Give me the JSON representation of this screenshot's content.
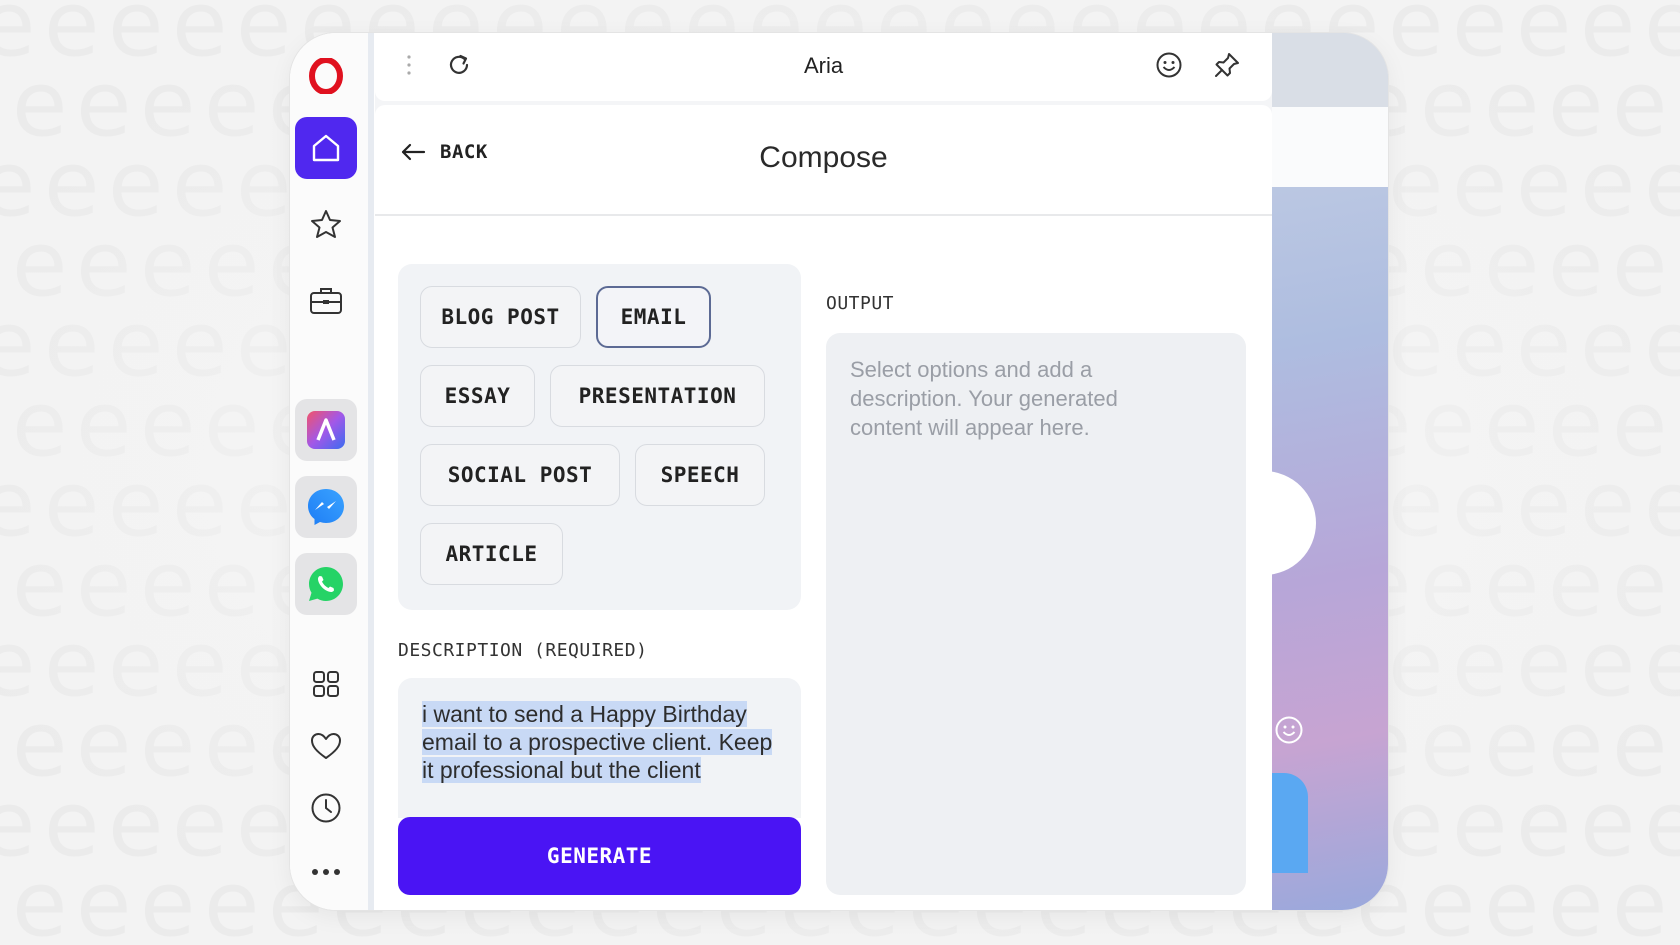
{
  "window": {
    "title": "Aria"
  },
  "sidebar": {
    "items": [
      {
        "icon": "opera-logo-icon",
        "active": false
      },
      {
        "icon": "home-icon",
        "active": true
      },
      {
        "icon": "star-icon",
        "active": false
      },
      {
        "icon": "briefcase-icon",
        "active": false
      },
      {
        "icon": "aria-app-icon",
        "active": false
      },
      {
        "icon": "messenger-icon",
        "active": false
      },
      {
        "icon": "whatsapp-icon",
        "active": false
      },
      {
        "icon": "grid-icon",
        "active": false
      },
      {
        "icon": "heart-icon",
        "active": false
      },
      {
        "icon": "clock-icon",
        "active": false
      },
      {
        "icon": "more-icon",
        "active": false
      }
    ]
  },
  "compose": {
    "back_label": "BACK",
    "title": "Compose",
    "types": [
      "BLOG POST",
      "EMAIL",
      "ESSAY",
      "PRESENTATION",
      "SOCIAL POST",
      "SPEECH",
      "ARTICLE"
    ],
    "selected_type": "EMAIL",
    "description_label": "DESCRIPTION (REQUIRED)",
    "description_value": "i want to send a Happy Birthday email to a prospective client. Keep it professional but the client",
    "generate_label": "GENERATE",
    "output_label": "OUTPUT",
    "output_placeholder": "Select options and add a description. Your generated content will appear here."
  },
  "colors": {
    "accent": "#4a14f4",
    "active_sidebar": "#5028ef",
    "selected_chip_border": "#5c6a94"
  }
}
